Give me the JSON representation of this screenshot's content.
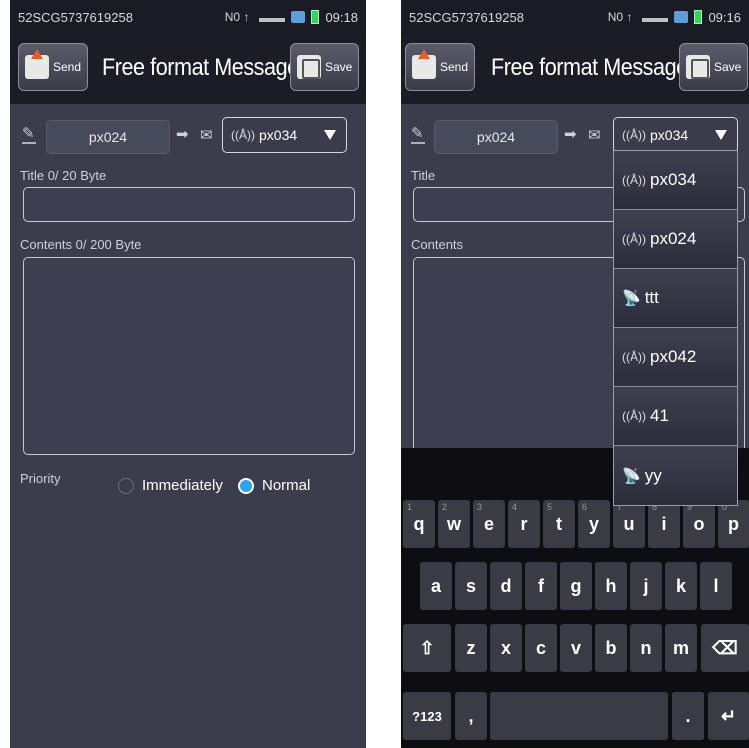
{
  "status": {
    "id": "52SCG5737619258",
    "net": "N0 ↑",
    "time_left": "09:18",
    "time_right": "09:16"
  },
  "header": {
    "send_label": "Send",
    "title": "Free format Message",
    "save_label": "Save"
  },
  "compose": {
    "sender": "px024",
    "recipient": "px034",
    "title_label_left": "Title  0/ 20 Byte",
    "title_label_right": "Title",
    "contents_label_left": "Contents   0/ 200 Byte",
    "contents_label_right": "Contents",
    "priority_label": "Priority",
    "priority_options": [
      "Immediately",
      "Normal"
    ],
    "priority_selected": "Normal"
  },
  "dropdown": {
    "items": [
      {
        "label": "px034",
        "icon": "tower-icon"
      },
      {
        "label": "px024",
        "icon": "tower-icon"
      },
      {
        "label": "ttt",
        "icon": "dish-icon"
      },
      {
        "label": "px042",
        "icon": "tower-icon"
      },
      {
        "label": "41",
        "icon": "tower-icon"
      },
      {
        "label": "yy",
        "icon": "dish-icon"
      }
    ]
  },
  "keyboard": {
    "row1": [
      "q",
      "w",
      "e",
      "r",
      "t",
      "y",
      "u",
      "i",
      "o",
      "p"
    ],
    "row1_hints": [
      "1",
      "2",
      "3",
      "4",
      "5",
      "6",
      "7",
      "8",
      "9",
      "0"
    ],
    "row2": [
      "a",
      "s",
      "d",
      "f",
      "g",
      "h",
      "j",
      "k",
      "l"
    ],
    "row3": [
      "z",
      "x",
      "c",
      "v",
      "b",
      "n",
      "m"
    ],
    "shift": "⇧",
    "backspace": "⌫",
    "symbols": "?123",
    "comma": ",",
    "period": ".",
    "enter": "↵"
  }
}
